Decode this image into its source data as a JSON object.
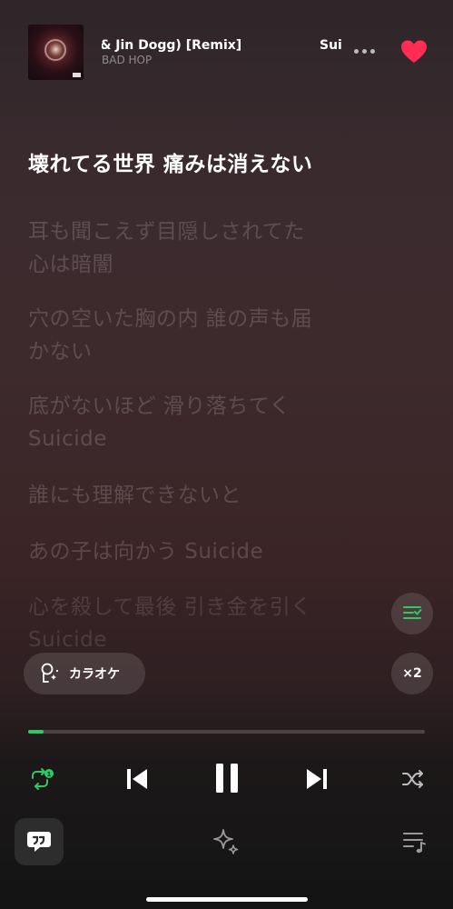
{
  "now_playing": {
    "title_visible": "eyoshi & Jin Dogg) [Remix]",
    "title_next_visible": "Sui",
    "artist": "BAD HOP",
    "liked": true
  },
  "lyrics": {
    "current_line": "壊れてる世界 痛みは消えない",
    "upcoming": [
      [
        "耳も聞こえず目隠しされてた",
        "心は暗闇"
      ],
      [
        "穴の空いた胸の内 誰の声も届",
        "かない"
      ],
      [
        "底がないほど 滑り落ちてく",
        "Suicide"
      ],
      [
        "誰にも理解できないと"
      ],
      [
        "あの子は向かう Suicide"
      ],
      [
        "心を殺して最後 引き金を引く",
        "Suicide"
      ]
    ]
  },
  "controls": {
    "karaoke_label": "カラオケ",
    "speed_label": "×2",
    "progress_fraction": 0.04,
    "repeat_mode": "repeat-one",
    "playing": true
  },
  "colors": {
    "accent": "#2ec964",
    "heart": "#ff2d55"
  },
  "icons": [
    "album-art",
    "more-icon",
    "heart-icon",
    "queue-icon",
    "karaoke-mic-icon",
    "repeat-one-icon",
    "previous-icon",
    "pause-icon",
    "next-icon",
    "shuffle-icon",
    "lyrics-bubble-icon",
    "sparkle-icon",
    "playlist-icon"
  ]
}
